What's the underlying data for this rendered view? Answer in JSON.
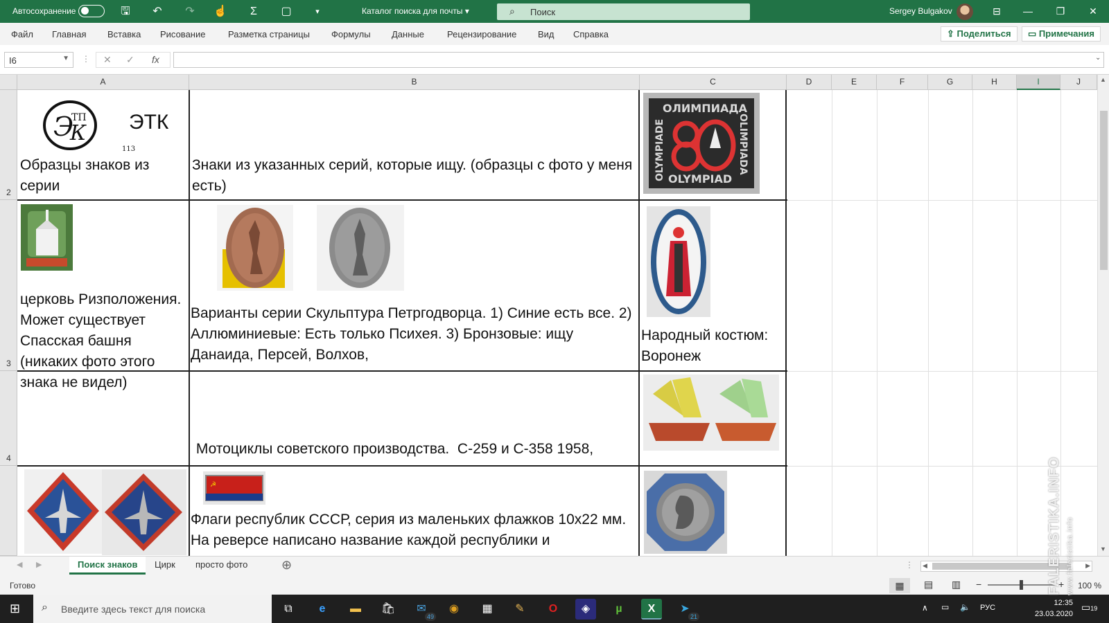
{
  "titlebar": {
    "autosave_label": "Автосохранение",
    "document_title": "Каталог поиска для почты",
    "search_placeholder": "Поиск",
    "user_name": "Sergey Bulgakov"
  },
  "menu": {
    "items": [
      "Файл",
      "Главная",
      "Вставка",
      "Рисование",
      "Разметка страницы",
      "Формулы",
      "Данные",
      "Рецензирование",
      "Вид",
      "Справка"
    ],
    "share_label": "Поделиться",
    "notes_label": "Примечания"
  },
  "formula_bar": {
    "name_box": "I6",
    "formula_value": ""
  },
  "columns": [
    "A",
    "B",
    "C",
    "D",
    "E",
    "F",
    "G",
    "H",
    "I",
    "J"
  ],
  "selected_column": "I",
  "rows": [
    "2",
    "3",
    "4",
    ""
  ],
  "cells": {
    "r2_a_logo": "ЭТК",
    "r2_a_logo_mark": "ЭТП К",
    "r2_a_small": "113",
    "r2_a": "Образцы знаков из серии",
    "r2_b": "Знаки из указанных серий, которые ищу. (образцы с фото у меня есть)",
    "r3_a": " церковь Ризположения. Может существует Спасская башня (никаких фото этого знака не видел)",
    "r3_b": "Варианты серии Скульптура Петргодворца. 1) Синие есть все. 2) Аллюминиевые: Есть только Психея. 3) Бронзовые: ищу Данаида, Персей, Волхов,",
    "r3_c": "Народный костюм: Воронеж",
    "r4_b": " Мотоциклы советского производства.  С-259 и С-358 1958,",
    "r5_b": "Флаги республик СССР, серия из маленьких флажков 10х22 мм. На реверсе написано название каждой республики и"
  },
  "sheet_tabs": [
    "Поиск знаков",
    "Цирк",
    "просто фото"
  ],
  "active_tab": "Поиск знаков",
  "status": {
    "ready": "Готово",
    "zoom": "100 %"
  },
  "taskbar": {
    "search_placeholder": "Введите здесь текст для поиска",
    "mail_badge": "49",
    "telegram_badge": "21",
    "language": "РУС",
    "time": "12:35",
    "date": "23.03.2020",
    "notifications": "19"
  },
  "watermark": {
    "main": "FALERISTIKA.INFO",
    "sub": "www.faleristika.info"
  },
  "colors": {
    "excel_green": "#217346",
    "grid_border": "#222222"
  }
}
